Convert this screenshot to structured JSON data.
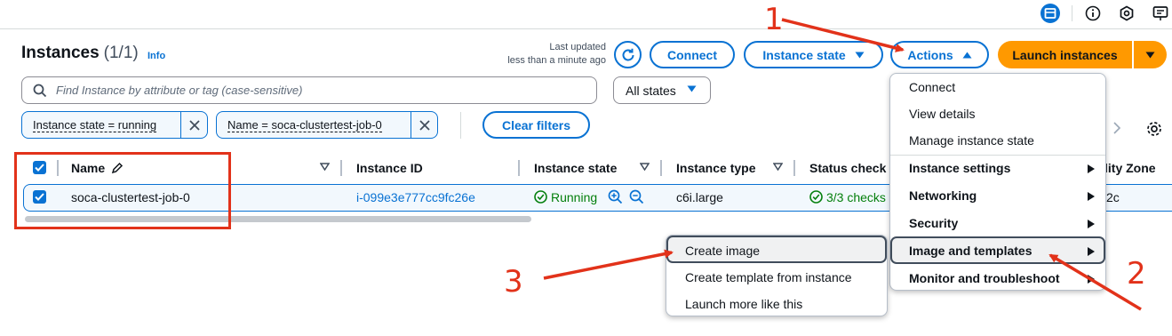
{
  "page": {
    "title": "Instances",
    "count": "(1/1)",
    "info": "Info",
    "last_updated_line1": "Last updated",
    "last_updated_line2": "less than a minute ago"
  },
  "toolbar": {
    "connect": "Connect",
    "instance_state": "Instance state",
    "actions": "Actions",
    "launch": "Launch instances"
  },
  "search": {
    "placeholder": "Find Instance by attribute or tag (case-sensitive)",
    "states_select": "All states"
  },
  "filters": {
    "tokens": [
      "Instance state = running",
      "Name = soca-clustertest-job-0"
    ],
    "clear": "Clear filters"
  },
  "table": {
    "headers": [
      "Name",
      "Instance ID",
      "Instance state",
      "Instance type",
      "Status check",
      "lity Zone"
    ],
    "row": {
      "name": "soca-clustertest-job-0",
      "instance_id": "i-099e3e777cc9fc26e",
      "state": "Running",
      "type": "c6i.large",
      "status_check": "3/3 checks",
      "zone": "2c"
    }
  },
  "actions_menu": {
    "items": [
      "Connect",
      "View details",
      "Manage instance state",
      "Instance settings",
      "Networking",
      "Security",
      "Image and templates",
      "Monitor and troubleshoot"
    ]
  },
  "submenu": {
    "items": [
      "Create image",
      "Create template from instance",
      "Launch more like this"
    ]
  },
  "annotations": {
    "n1": "1",
    "n2": "2",
    "n3": "3"
  },
  "colors": {
    "accent": "#0972d3",
    "launch": "#ff9900",
    "annotation": "#e2321a",
    "success": "#037f0c"
  }
}
